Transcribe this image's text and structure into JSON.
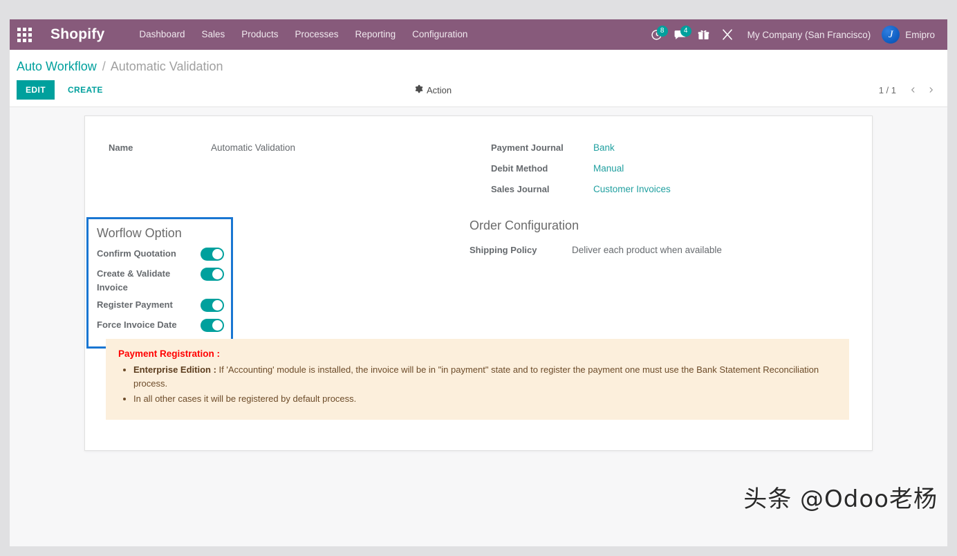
{
  "navbar": {
    "apps_icon": "apps-grid-icon",
    "brand": "Shopify",
    "menu": [
      {
        "label": "Dashboard"
      },
      {
        "label": "Sales"
      },
      {
        "label": "Products"
      },
      {
        "label": "Processes"
      },
      {
        "label": "Reporting"
      },
      {
        "label": "Configuration"
      }
    ],
    "icons": [
      {
        "name": "activity-clock-icon",
        "badge": "8"
      },
      {
        "name": "messages-chat-icon",
        "badge": "4"
      },
      {
        "name": "gift-box-icon",
        "badge": ""
      },
      {
        "name": "tools-cross-icon",
        "badge": ""
      }
    ],
    "company": "My Company (San Francisco)",
    "user": "Emipro",
    "avatar_glyph": "J",
    "bg_color": "#875a7b",
    "badge_color": "#00a09d"
  },
  "controlpanel": {
    "breadcrumb_root": "Auto Workflow",
    "breadcrumb_sep": "/",
    "breadcrumb_current": "Automatic Validation",
    "edit_label": "EDIT",
    "create_label": "CREATE",
    "action_label": "Action",
    "action_icon": "gear-icon",
    "pager_value": "1 / 1",
    "prev_icon": "chevron-left-icon",
    "next_icon": "chevron-right-icon",
    "accent_color": "#00a09d"
  },
  "form": {
    "left_fields": [
      {
        "label": "Name",
        "value": "Automatic Validation",
        "is_link": false
      }
    ],
    "right_fields": [
      {
        "label": "Payment Journal",
        "value": "Bank",
        "is_link": true
      },
      {
        "label": "Debit Method",
        "value": "Manual",
        "is_link": true
      },
      {
        "label": "Sales Journal",
        "value": "Customer Invoices",
        "is_link": true
      }
    ],
    "workflow_group": {
      "title": "Worflow Option",
      "highlight_color": "#1976d2",
      "options": [
        {
          "label": "Confirm Quotation",
          "enabled": true
        },
        {
          "label": "Create & Validate Invoice",
          "enabled": true
        },
        {
          "label": "Register Payment",
          "enabled": true
        },
        {
          "label": "Force Invoice Date",
          "enabled": true
        }
      ]
    },
    "order_config": {
      "title": "Order Configuration",
      "fields": [
        {
          "label": "Shipping Policy",
          "value": "Deliver each product when available"
        }
      ]
    },
    "alert": {
      "title": "Payment Registration :",
      "title_color": "#ff0000",
      "bg_color": "#fcefdc",
      "items": [
        {
          "bold": "Enterprise Edition :",
          "text": " If 'Accounting' module is installed, the invoice will be in \"in payment\" state and to register the payment one must use the Bank Statement Reconciliation process."
        },
        {
          "bold": "",
          "text": "In all other cases it will be registered by default process."
        }
      ]
    }
  },
  "watermark": "头条 @Odoo老杨"
}
